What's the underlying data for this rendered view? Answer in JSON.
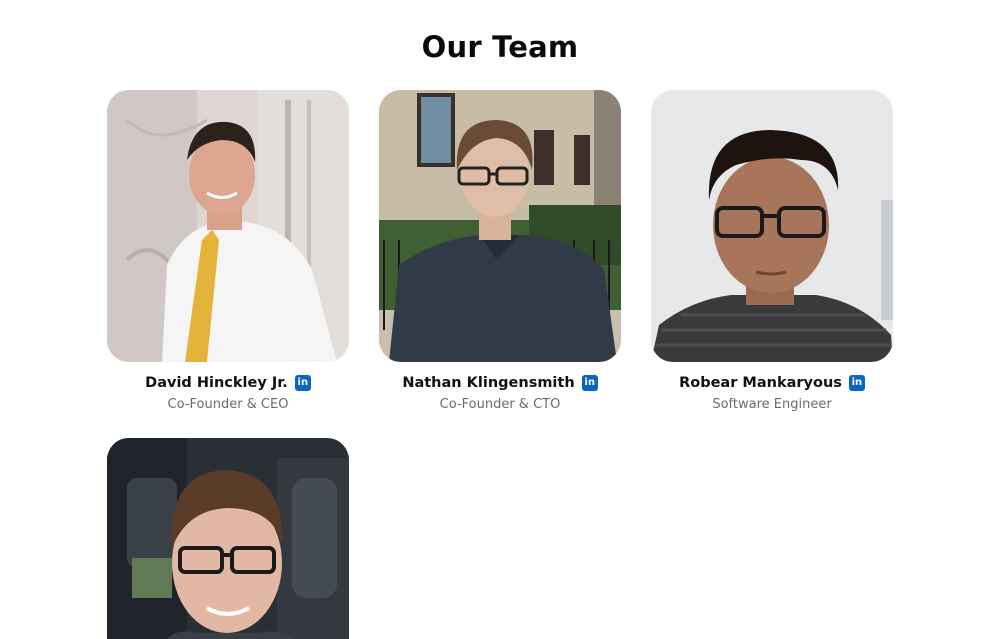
{
  "section": {
    "title": "Our Team"
  },
  "members": [
    {
      "name": "David Hinckley Jr.",
      "role": "Co-Founder & CEO",
      "social_icon": "linkedin-icon",
      "social_label": "in"
    },
    {
      "name": "Nathan Klingensmith",
      "role": "Co-Founder & CTO",
      "social_icon": "linkedin-icon",
      "social_label": "in"
    },
    {
      "name": "Robear Mankaryous",
      "role": "Software Engineer",
      "social_icon": "linkedin-icon",
      "social_label": "in"
    },
    {
      "name": "",
      "role": "",
      "social_icon": "",
      "social_label": ""
    }
  ],
  "colors": {
    "linkedin": "#0a66c2",
    "role_text": "#6b6b6b",
    "title_text": "#0a0a0a"
  }
}
